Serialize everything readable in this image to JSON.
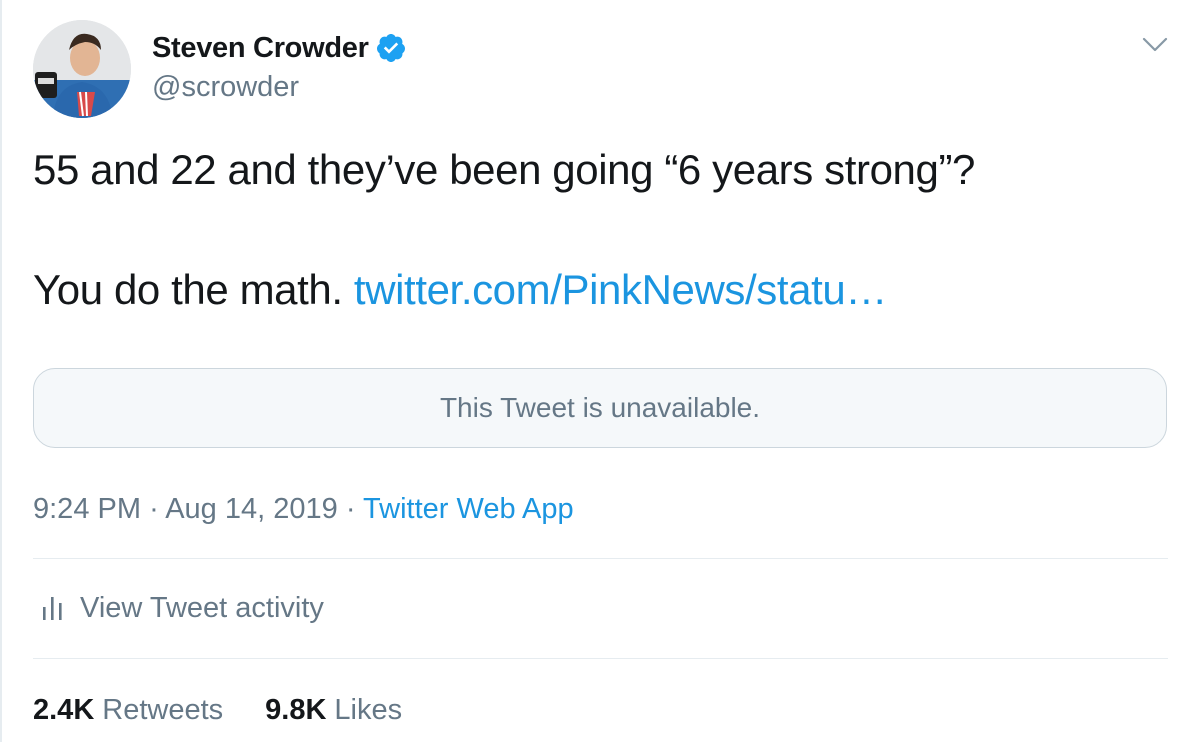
{
  "author": {
    "name": "Steven Crowder",
    "handle": "@scrowder",
    "verified": true
  },
  "tweet": {
    "line1": "55 and 22 and they’ve been going “6 years strong”?",
    "line2_text": "You do the math.",
    "link_text": "twitter.com/PinkNews/statu…"
  },
  "quoted_tweet": {
    "message": "This Tweet is unavailable."
  },
  "meta": {
    "time": "9:24 PM",
    "separator1": "·",
    "date": "Aug 14, 2019",
    "separator2": "·",
    "source": "Twitter Web App"
  },
  "activity": {
    "label": "View Tweet activity"
  },
  "stats": {
    "retweets_count": "2.4K",
    "retweets_label": "Retweets",
    "likes_count": "9.8K",
    "likes_label": "Likes"
  },
  "colors": {
    "link": "#1b95e0",
    "secondary_text": "#657786",
    "primary_text": "#14171a",
    "divider": "#e6ecf0",
    "verified_badge": "#1da1f2"
  },
  "icons": {
    "caret": "chevron-down-icon",
    "verified": "verified-badge-icon",
    "activity": "bar-chart-icon"
  }
}
